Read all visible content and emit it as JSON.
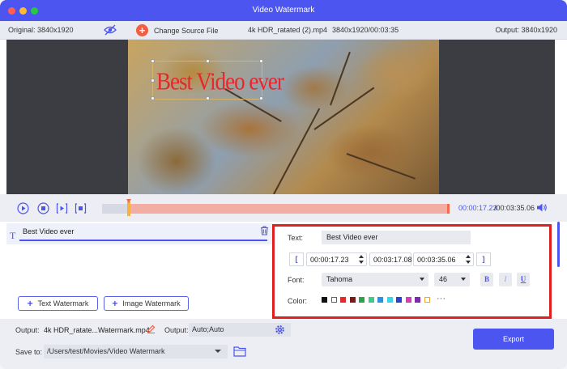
{
  "window": {
    "title": "Video Watermark"
  },
  "infobar": {
    "original": "Original: 3840x1920",
    "change_source": "Change Source File",
    "file_name": "4k HDR_ratated (2).mp4",
    "resolution_duration": "3840x1920/00:03:35",
    "output": "Output: 3840x1920"
  },
  "preview": {
    "watermark_text": "Best Video ever"
  },
  "player": {
    "current_time": "00:00:17.23",
    "total_time": "/00:03:35.06",
    "selection_start_fraction": 0.08,
    "selection_end_fraction": 1.0
  },
  "watermark_list": {
    "items": [
      {
        "label": "Best Video ever"
      }
    ],
    "add_text": "Text Watermark",
    "add_image": "Image Watermark"
  },
  "settings": {
    "text_label": "Text:",
    "text_value": "Best Video ever",
    "bracket_open": "[",
    "bracket_close": "]",
    "start_time": "00:00:17.23",
    "duration": "00:03:17.08",
    "end_time": "00:03:35.06",
    "font_label": "Font:",
    "font_name": "Tahoma",
    "font_size": "46",
    "bold": "B",
    "italic": "I",
    "underline": "U",
    "color_label": "Color:",
    "colors": [
      "#111111",
      "#ffffff",
      "#e32a2a",
      "#7a1a1a",
      "#2ba34a",
      "#3ccb8a",
      "#2f8fe3",
      "#38d6e8",
      "#2a3fd6",
      "#d43bbd",
      "#7a2bb0",
      "#f0a71c"
    ],
    "more": "···"
  },
  "bottom": {
    "output_label": "Output:",
    "output_file": "4k HDR_ratate...Watermark.mp4",
    "output_label2": "Output:",
    "output_format": "Auto;Auto",
    "save_label": "Save to:",
    "save_path": "/Users/test/Movies/Video Watermark",
    "export": "Export"
  },
  "accent": "#4c55ef"
}
